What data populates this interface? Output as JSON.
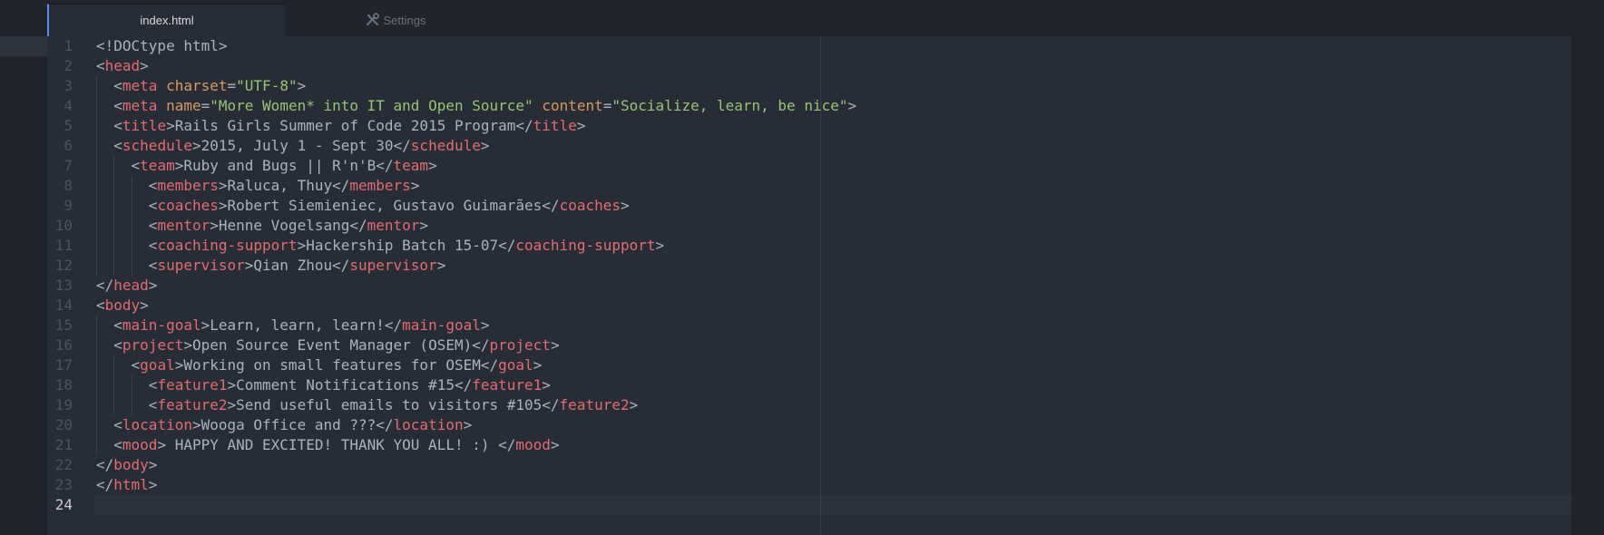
{
  "tabs": [
    {
      "label": "index.html",
      "active": true
    },
    {
      "label": "Settings",
      "active": false,
      "icon": "tools-icon"
    }
  ],
  "editor": {
    "current_line": 24,
    "lines": [
      {
        "n": "1",
        "indent": 0,
        "tokens": [
          {
            "c": "p",
            "v": "<!DOCtype html>"
          }
        ]
      },
      {
        "n": "2",
        "indent": 0,
        "tokens": [
          {
            "c": "p",
            "v": "<"
          },
          {
            "c": "t",
            "v": "head"
          },
          {
            "c": "p",
            "v": ">"
          }
        ]
      },
      {
        "n": "3",
        "indent": 1,
        "tokens": [
          {
            "c": "p",
            "v": "<"
          },
          {
            "c": "t",
            "v": "meta"
          },
          {
            "c": "p",
            "v": " "
          },
          {
            "c": "a",
            "v": "charset"
          },
          {
            "c": "p",
            "v": "="
          },
          {
            "c": "s",
            "v": "\"UTF-8\""
          },
          {
            "c": "p",
            "v": ">"
          }
        ]
      },
      {
        "n": "4",
        "indent": 1,
        "tokens": [
          {
            "c": "p",
            "v": "<"
          },
          {
            "c": "t",
            "v": "meta"
          },
          {
            "c": "p",
            "v": " "
          },
          {
            "c": "a",
            "v": "name"
          },
          {
            "c": "p",
            "v": "="
          },
          {
            "c": "s",
            "v": "\"More Women* into IT and Open Source\""
          },
          {
            "c": "p",
            "v": " "
          },
          {
            "c": "a",
            "v": "content"
          },
          {
            "c": "p",
            "v": "="
          },
          {
            "c": "s",
            "v": "\"Socialize, learn, be nice\""
          },
          {
            "c": "p",
            "v": ">"
          }
        ]
      },
      {
        "n": "5",
        "indent": 1,
        "tokens": [
          {
            "c": "p",
            "v": "<"
          },
          {
            "c": "t",
            "v": "title"
          },
          {
            "c": "p",
            "v": ">Rails Girls Summer of Code 2015 Program</"
          },
          {
            "c": "t",
            "v": "title"
          },
          {
            "c": "p",
            "v": ">"
          }
        ]
      },
      {
        "n": "6",
        "indent": 1,
        "tokens": [
          {
            "c": "p",
            "v": "<"
          },
          {
            "c": "t",
            "v": "schedule"
          },
          {
            "c": "p",
            "v": ">2015, July 1 - Sept 30</"
          },
          {
            "c": "t",
            "v": "schedule"
          },
          {
            "c": "p",
            "v": ">"
          }
        ]
      },
      {
        "n": "7",
        "indent": 2,
        "tokens": [
          {
            "c": "p",
            "v": "<"
          },
          {
            "c": "t",
            "v": "team"
          },
          {
            "c": "p",
            "v": ">Ruby and Bugs || R'n'B</"
          },
          {
            "c": "t",
            "v": "team"
          },
          {
            "c": "p",
            "v": ">"
          }
        ]
      },
      {
        "n": "8",
        "indent": 3,
        "tokens": [
          {
            "c": "p",
            "v": "<"
          },
          {
            "c": "t",
            "v": "members"
          },
          {
            "c": "p",
            "v": ">Raluca, Thuy</"
          },
          {
            "c": "t",
            "v": "members"
          },
          {
            "c": "p",
            "v": ">"
          }
        ]
      },
      {
        "n": "9",
        "indent": 3,
        "tokens": [
          {
            "c": "p",
            "v": "<"
          },
          {
            "c": "t",
            "v": "coaches"
          },
          {
            "c": "p",
            "v": ">Robert Siemieniec, Gustavo Guimarães</"
          },
          {
            "c": "t",
            "v": "coaches"
          },
          {
            "c": "p",
            "v": ">"
          }
        ]
      },
      {
        "n": "10",
        "indent": 3,
        "tokens": [
          {
            "c": "p",
            "v": "<"
          },
          {
            "c": "t",
            "v": "mentor"
          },
          {
            "c": "p",
            "v": ">Henne Vogelsang</"
          },
          {
            "c": "t",
            "v": "mentor"
          },
          {
            "c": "p",
            "v": ">"
          }
        ]
      },
      {
        "n": "11",
        "indent": 3,
        "tokens": [
          {
            "c": "p",
            "v": "<"
          },
          {
            "c": "t",
            "v": "coaching-support"
          },
          {
            "c": "p",
            "v": ">Hackership Batch 15-07</"
          },
          {
            "c": "t",
            "v": "coaching-support"
          },
          {
            "c": "p",
            "v": ">"
          }
        ]
      },
      {
        "n": "12",
        "indent": 3,
        "tokens": [
          {
            "c": "p",
            "v": "<"
          },
          {
            "c": "t",
            "v": "supervisor"
          },
          {
            "c": "p",
            "v": ">Qian Zhou</"
          },
          {
            "c": "t",
            "v": "supervisor"
          },
          {
            "c": "p",
            "v": ">"
          }
        ]
      },
      {
        "n": "13",
        "indent": 0,
        "tokens": [
          {
            "c": "p",
            "v": "</"
          },
          {
            "c": "t",
            "v": "head"
          },
          {
            "c": "p",
            "v": ">"
          }
        ]
      },
      {
        "n": "14",
        "indent": 0,
        "tokens": [
          {
            "c": "p",
            "v": "<"
          },
          {
            "c": "t",
            "v": "body"
          },
          {
            "c": "p",
            "v": ">"
          }
        ]
      },
      {
        "n": "15",
        "indent": 1,
        "tokens": [
          {
            "c": "p",
            "v": "<"
          },
          {
            "c": "t",
            "v": "main-goal"
          },
          {
            "c": "p",
            "v": ">Learn, learn, learn!</"
          },
          {
            "c": "t",
            "v": "main-goal"
          },
          {
            "c": "p",
            "v": ">"
          }
        ]
      },
      {
        "n": "16",
        "indent": 1,
        "tokens": [
          {
            "c": "p",
            "v": "<"
          },
          {
            "c": "t",
            "v": "project"
          },
          {
            "c": "p",
            "v": ">Open Source Event Manager (OSEM)</"
          },
          {
            "c": "t",
            "v": "project"
          },
          {
            "c": "p",
            "v": ">"
          }
        ]
      },
      {
        "n": "17",
        "indent": 2,
        "tokens": [
          {
            "c": "p",
            "v": "<"
          },
          {
            "c": "t",
            "v": "goal"
          },
          {
            "c": "p",
            "v": ">Working on small features for OSEM</"
          },
          {
            "c": "t",
            "v": "goal"
          },
          {
            "c": "p",
            "v": ">"
          }
        ]
      },
      {
        "n": "18",
        "indent": 3,
        "tokens": [
          {
            "c": "p",
            "v": "<"
          },
          {
            "c": "t",
            "v": "feature1"
          },
          {
            "c": "p",
            "v": ">Comment Notifications #15</"
          },
          {
            "c": "t",
            "v": "feature1"
          },
          {
            "c": "p",
            "v": ">"
          }
        ]
      },
      {
        "n": "19",
        "indent": 3,
        "tokens": [
          {
            "c": "p",
            "v": "<"
          },
          {
            "c": "t",
            "v": "feature2"
          },
          {
            "c": "p",
            "v": ">Send useful emails to visitors #105</"
          },
          {
            "c": "t",
            "v": "feature2"
          },
          {
            "c": "p",
            "v": ">"
          }
        ]
      },
      {
        "n": "20",
        "indent": 1,
        "tokens": [
          {
            "c": "p",
            "v": "<"
          },
          {
            "c": "t",
            "v": "location"
          },
          {
            "c": "p",
            "v": ">Wooga Office and ???</"
          },
          {
            "c": "t",
            "v": "location"
          },
          {
            "c": "p",
            "v": ">"
          }
        ]
      },
      {
        "n": "21",
        "indent": 1,
        "tokens": [
          {
            "c": "p",
            "v": "<"
          },
          {
            "c": "t",
            "v": "mood"
          },
          {
            "c": "p",
            "v": "> HAPPY AND EXCITED! THANK YOU ALL! :) </"
          },
          {
            "c": "t",
            "v": "mood"
          },
          {
            "c": "p",
            "v": ">"
          }
        ]
      },
      {
        "n": "22",
        "indent": 0,
        "tokens": [
          {
            "c": "p",
            "v": "</"
          },
          {
            "c": "t",
            "v": "body"
          },
          {
            "c": "p",
            "v": ">"
          }
        ]
      },
      {
        "n": "23",
        "indent": 0,
        "tokens": [
          {
            "c": "p",
            "v": "</"
          },
          {
            "c": "t",
            "v": "html"
          },
          {
            "c": "p",
            "v": ">"
          }
        ]
      },
      {
        "n": "24",
        "indent": 0,
        "tokens": []
      }
    ]
  },
  "colors": {
    "tag": "#e06c75",
    "attribute": "#d19a66",
    "string": "#98c379",
    "text": "#abb2bf",
    "background": "#282c34",
    "accent": "#568af2"
  }
}
